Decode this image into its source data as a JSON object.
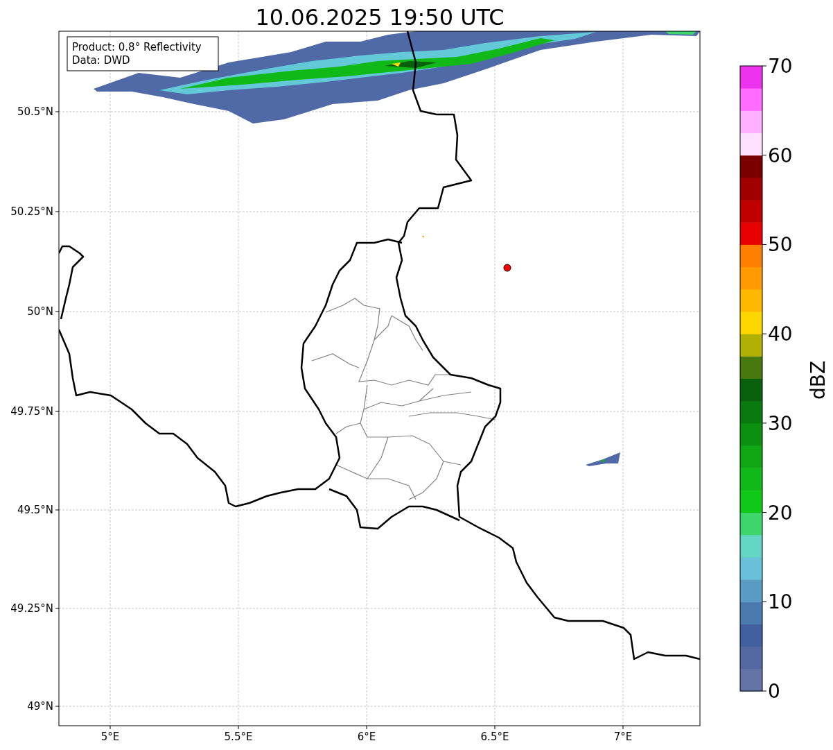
{
  "title": "10.06.2025 19:50 UTC",
  "info_box": [
    "Product: 0.8° Reflectivity",
    "Data: DWD"
  ],
  "x_ticks": [
    "5°E",
    "5.5°E",
    "6°E",
    "6.5°E",
    "7°E"
  ],
  "y_ticks": [
    "50.5°N",
    "50.25°N",
    "50°N",
    "49.75°N",
    "49.5°N",
    "49.25°N",
    "49°N"
  ],
  "colorbar": {
    "label": "dBZ",
    "ticks": [
      "70",
      "60",
      "50",
      "40",
      "30",
      "20",
      "10",
      "0"
    ],
    "segments": [
      {
        "color": "#6474a6"
      },
      {
        "color": "#5469a2"
      },
      {
        "color": "#4260a0"
      },
      {
        "color": "#4a7ab0"
      },
      {
        "color": "#5b9cc4"
      },
      {
        "color": "#68c0d9"
      },
      {
        "color": "#63d6c4"
      },
      {
        "color": "#3ed66c"
      },
      {
        "color": "#10c818"
      },
      {
        "color": "#10b918"
      },
      {
        "color": "#0ea612"
      },
      {
        "color": "#0c9010"
      },
      {
        "color": "#0b7a0e"
      },
      {
        "color": "#08600c"
      },
      {
        "color": "#47790e"
      },
      {
        "color": "#b0b005"
      },
      {
        "color": "#ffd700"
      },
      {
        "color": "#ffb800"
      },
      {
        "color": "#ff9a00"
      },
      {
        "color": "#ff7f00"
      },
      {
        "color": "#e60000"
      },
      {
        "color": "#c00000"
      },
      {
        "color": "#a00000"
      },
      {
        "color": "#7a0000"
      },
      {
        "color": "#ffe0ff"
      },
      {
        "color": "#ffb0ff"
      },
      {
        "color": "#ff6cff"
      },
      {
        "color": "#ee33ee"
      }
    ]
  }
}
